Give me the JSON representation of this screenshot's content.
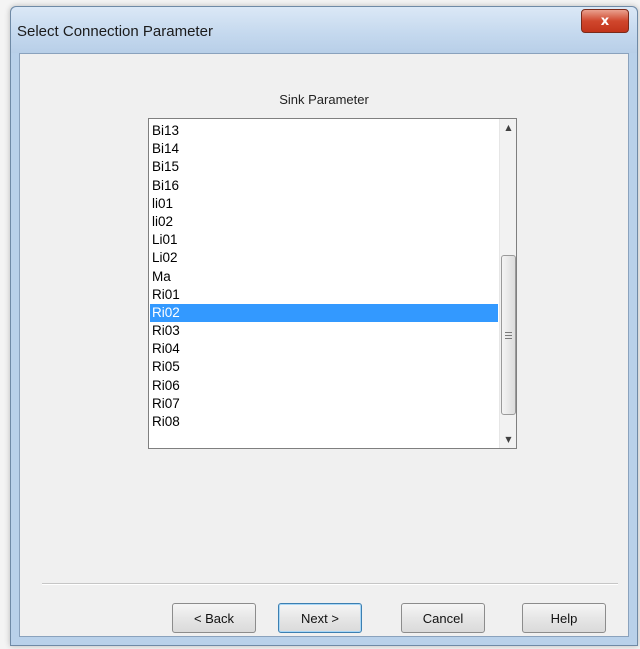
{
  "window": {
    "title": "Select Connection Parameter",
    "close_glyph": "x"
  },
  "sink_list": {
    "title": "Sink Parameter",
    "items": [
      "Bi13",
      "Bi14",
      "Bi15",
      "Bi16",
      "li01",
      "li02",
      "Li01",
      "Li02",
      "Ma",
      "Ri01",
      "Ri02",
      "Ri03",
      "Ri04",
      "Ri05",
      "Ri06",
      "Ri07",
      "Ri08"
    ],
    "selected": "Ri02"
  },
  "buttons": {
    "back": "< Back",
    "next": "Next >",
    "cancel": "Cancel",
    "help": "Help"
  },
  "colors": {
    "selection": "#3399ff",
    "close_button": "#c2341b"
  }
}
